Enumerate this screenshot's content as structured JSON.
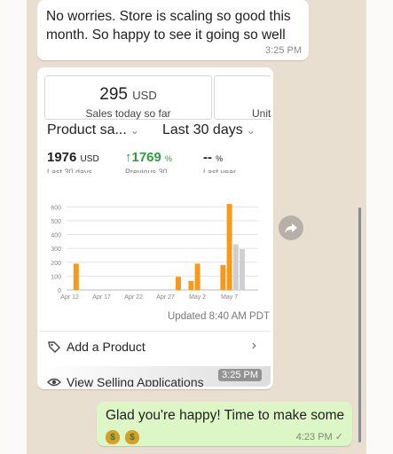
{
  "messages": [
    {
      "text": "No worries. Store is scaling so good this month. So happy to see it going so well",
      "time": "3:25 PM"
    },
    {
      "time": "3:25 PM",
      "screenshot": {
        "sales_value": "295",
        "sales_unit": "USD",
        "sales_label": "Sales today so far",
        "card2_label": "Unit",
        "dropdown_product": "Product sa...",
        "dropdown_range": "Last 30 days",
        "stat_total": "1976",
        "stat_total_unit": "USD",
        "stat_total_sub": "Last 30 days",
        "stat_change": "1769",
        "stat_change_unit": "%",
        "stat_change_sub": "Previous 30",
        "stat_year": "--",
        "stat_year_unit": "%",
        "stat_year_sub": "Last year",
        "updated": "Updated 8:40 AM PDT",
        "rows": [
          {
            "label": "Add a Product",
            "icon": "tag-icon"
          },
          {
            "label": "View Selling Applications",
            "icon": "eye-icon"
          }
        ]
      }
    },
    {
      "text": "Glad you're happy! Time to make some",
      "emojis": [
        "$",
        "$"
      ],
      "time": "4:23 PM ✓"
    }
  ],
  "chart_data": {
    "type": "bar",
    "x": [
      "Apr 12",
      "Apr 13",
      "Apr 14",
      "Apr 15",
      "Apr 16",
      "Apr 17",
      "Apr 18",
      "Apr 19",
      "Apr 20",
      "Apr 21",
      "Apr 22",
      "Apr 23",
      "Apr 24",
      "Apr 25",
      "Apr 26",
      "Apr 27",
      "Apr 28",
      "Apr 29",
      "Apr 30",
      "May 1",
      "May 2",
      "May 3",
      "May 4",
      "May 5",
      "May 6",
      "May 7",
      "May 8",
      "May 9",
      "May 10",
      "May 11"
    ],
    "x_tick_labels": [
      "Apr 12",
      "Apr 17",
      "Apr 22",
      "Apr 27",
      "May 2",
      "May 7"
    ],
    "series": [
      {
        "values": [
          0,
          190,
          0,
          0,
          0,
          0,
          0,
          0,
          0,
          0,
          0,
          0,
          0,
          0,
          0,
          0,
          0,
          0,
          0,
          0,
          0,
          0,
          0,
          0,
          0,
          0,
          0,
          0,
          0,
          0
        ],
        "color": "#f59a1b"
      },
      {
        "values": [
          0,
          0,
          0,
          0,
          0,
          0,
          0,
          0,
          0,
          0,
          0,
          0,
          0,
          0,
          0,
          0,
          0,
          0,
          0,
          0,
          0,
          0,
          0,
          0,
          0,
          0,
          0,
          0,
          0,
          0
        ],
        "color": "#f59a1b"
      }
    ],
    "bars": [
      {
        "x": "Apr 13",
        "value": 190,
        "color": "#f59a1b"
      },
      {
        "x": "Apr 29",
        "value": 95,
        "color": "#f59a1b"
      },
      {
        "x": "May 1",
        "value": 65,
        "color": "#f59a1b"
      },
      {
        "x": "May 2",
        "value": 190,
        "color": "#f59a1b"
      },
      {
        "x": "May 6",
        "value": 180,
        "color": "#f59a1b"
      },
      {
        "x": "May 7",
        "value": 620,
        "color": "#f59a1b"
      },
      {
        "x": "May 8",
        "value": 330,
        "color": "#cfcfcf"
      },
      {
        "x": "May 9",
        "value": 295,
        "color": "#cfcfcf"
      }
    ],
    "y_ticks": [
      0,
      100,
      200,
      300,
      400,
      500,
      600
    ],
    "ylim": [
      0,
      640
    ],
    "grid": true
  }
}
